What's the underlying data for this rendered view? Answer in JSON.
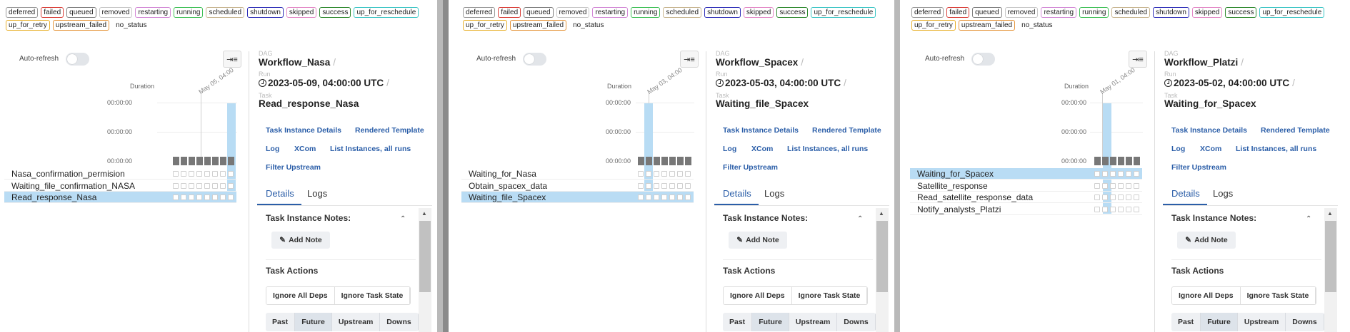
{
  "legend_states": [
    {
      "label": "deferred",
      "color": "#9a9a9a"
    },
    {
      "label": "failed",
      "color": "#d9403a"
    },
    {
      "label": "queued",
      "color": "#808080"
    },
    {
      "label": "removed",
      "color": "#c8c8c8"
    },
    {
      "label": "restarting",
      "color": "#d38ad6"
    },
    {
      "label": "running",
      "color": "#40c057"
    },
    {
      "label": "scheduled",
      "color": "#c8b590"
    },
    {
      "label": "shutdown",
      "color": "#3030b8"
    },
    {
      "label": "skipped",
      "color": "#e389c6"
    },
    {
      "label": "success",
      "color": "#2f8a2f"
    },
    {
      "label": "up_for_reschedule",
      "color": "#3ec5c5"
    },
    {
      "label": "up_for_retry",
      "color": "#e8b02d"
    },
    {
      "label": "upstream_failed",
      "color": "#e5953b"
    },
    {
      "label": "no_status",
      "color": "#ffffff"
    }
  ],
  "common": {
    "auto_refresh_label": "Auto-refresh",
    "duration_label": "Duration",
    "duration_ticks": [
      "00:00:00",
      "00:00:00",
      "00:00:00"
    ],
    "dag_label": "DAG",
    "run_label": "Run",
    "task_label": "Task",
    "links": {
      "task_instance_details": "Task Instance Details",
      "rendered_template": "Rendered Template",
      "log": "Log",
      "xcom": "XCom",
      "list_instances": "List Instances, all runs",
      "filter_upstream": "Filter Upstream"
    },
    "tabs": {
      "details": "Details",
      "logs": "Logs"
    },
    "task_instance_notes": "Task Instance Notes:",
    "add_note": "Add Note",
    "task_actions": "Task Actions",
    "ignore_all_deps": "Ignore All Deps",
    "ignore_task_state": "Ignore Task State",
    "past": "Past",
    "future": "Future",
    "upstream": "Upstream",
    "downstream": "Downs"
  },
  "panels": [
    {
      "dag": "Workflow_Nasa",
      "run": "2023-05-09, 04:00:00 UTC",
      "task": "Read_response_Nasa",
      "date_label": "May 05, 04:00",
      "tasks": [
        "Nasa_confirmation_permision",
        "Waiting_file_confirmation_NASA",
        "Read_response_Nasa"
      ],
      "selected_task": 2,
      "runs_count": 8
    },
    {
      "dag": "Workflow_Spacex",
      "run": "2023-05-03, 04:00:00 UTC",
      "task": "Waiting_file_Spacex",
      "date_label": "May 03, 04:00",
      "tasks": [
        "Waiting_for_Nasa",
        "Obtain_spacex_data",
        "Waiting_file_Spacex"
      ],
      "selected_task": 2,
      "runs_count": 7
    },
    {
      "dag": "Workflow_Platzi",
      "run": "2023-05-02, 04:00:00 UTC",
      "task": "Waiting_for_Spacex",
      "date_label": "May 01, 04:00",
      "tasks": [
        "Waiting_for_Spacex",
        "Satellite_response",
        "Read_satellite_response_data",
        "Notify_analysts_Platzi"
      ],
      "selected_task": 0,
      "runs_count": 6
    }
  ]
}
